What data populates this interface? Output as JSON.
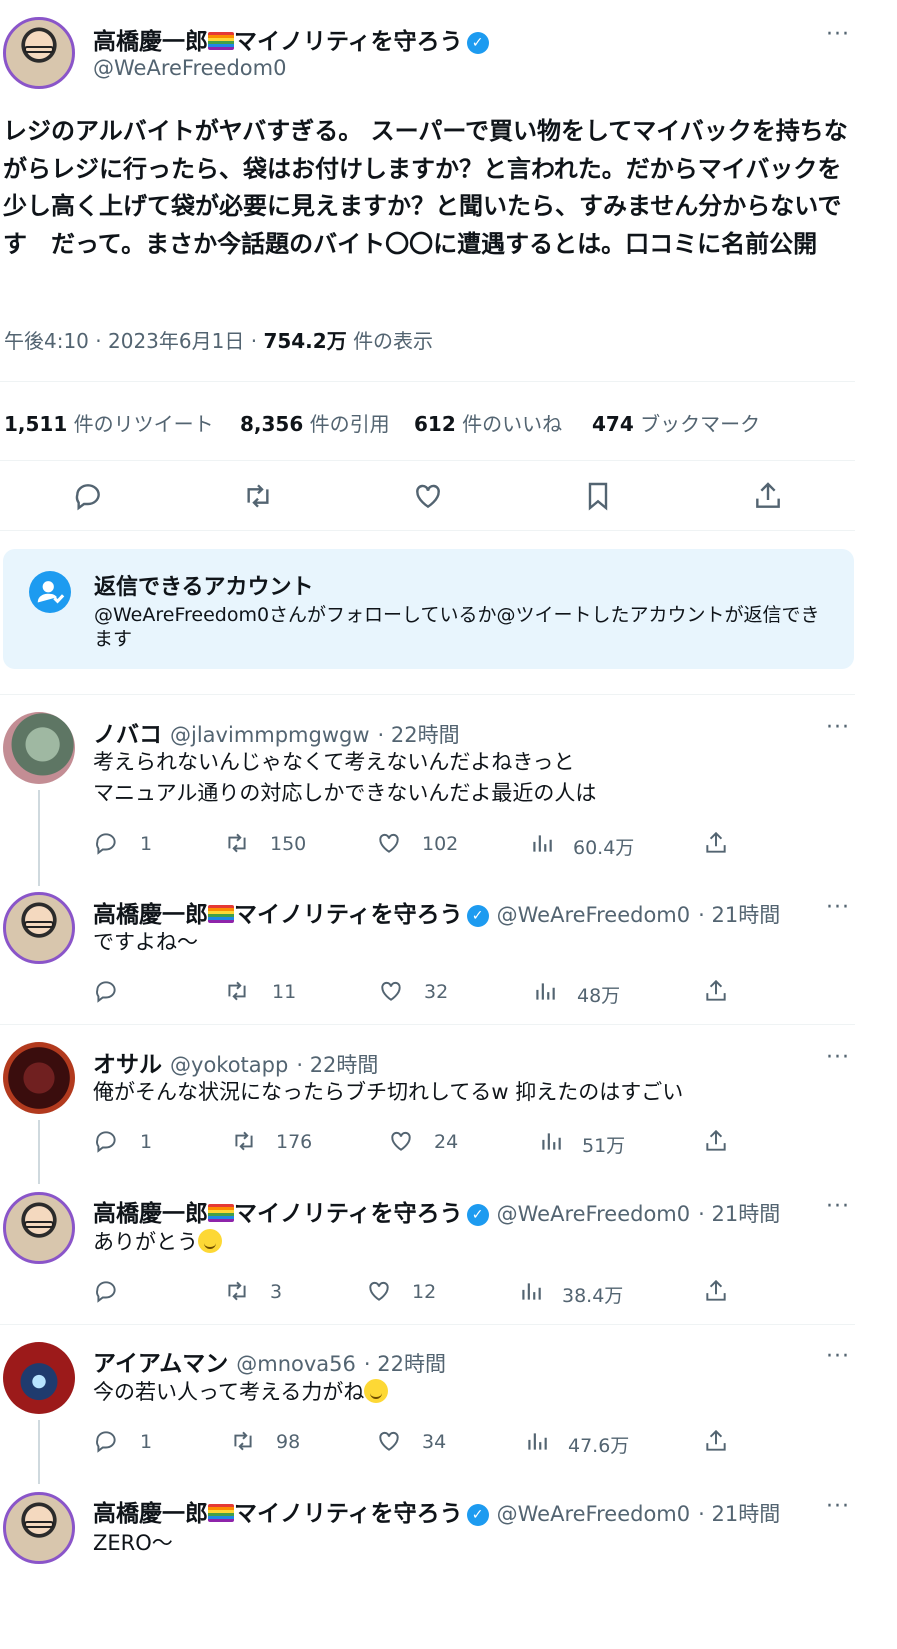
{
  "tweet": {
    "author_name": "高橋慶一郎",
    "author_name_suffix": "マイノリティを守ろう",
    "author_handle": "@WeAreFreedom0",
    "body": "レジのアルバイトがヤバすぎる。 スーパーで買い物をしてマイバックを持ちながらレジに行ったら、袋はお付けしますか？と言われた。だからマイバックを少し高く上げて袋が必要に見えますか？と聞いたら、すみません分からないです　だって。まさか今話題のバイト〇〇に遭遇するとは。口コミに名前公開",
    "time": "午後4:10",
    "date": "2023年6月1日",
    "views_count": "754.2万",
    "views_label": "件の表示",
    "more_icon": "more-dots-icon",
    "verified_icon": "verified-badge-icon"
  },
  "stats": {
    "retweets_count": "1,511",
    "retweets_label": "件のリツイート",
    "quotes_count": "8,356",
    "quotes_label": "件の引用",
    "likes_count": "612",
    "likes_label": "件のいいね",
    "bookmarks_count": "474",
    "bookmarks_label": "ブックマーク"
  },
  "actions": [
    "reply-icon",
    "retweet-icon",
    "like-icon",
    "bookmark-icon",
    "share-icon"
  ],
  "reply_restriction": {
    "title": "返信できるアカウント",
    "text": "@WeAreFreedom0さんがフォローしているか@ツイートしたアカウントが返信できます"
  },
  "replies": [
    {
      "name": "ノバコ",
      "handle": "@jlavimmpmgwgw",
      "time": "· 22時間",
      "text_lines": [
        "考えられないんじゃなくて考えないんだよねきっと",
        "マニュアル通りの対応しかできないんだよ最近の人は"
      ],
      "replies": "1",
      "retweets": "150",
      "likes": "102",
      "views": "60.4万"
    },
    {
      "name": "高橋慶一郎",
      "name_suffix": "マイノリティを守ろう",
      "handle": "@WeAreFreedom0",
      "time": "· 21時間",
      "text_lines": [
        "ですよね〜"
      ],
      "replies": "",
      "retweets": "11",
      "likes": "32",
      "views": "48万"
    },
    {
      "name": "オサル",
      "handle": "@yokotapp",
      "time": "· 22時間",
      "text_lines": [
        "俺がそんな状況になったらブチ切れしてるw 抑えたのはすごい"
      ],
      "replies": "1",
      "retweets": "176",
      "likes": "24",
      "views": "51万"
    },
    {
      "name": "高橋慶一郎",
      "name_suffix": "マイノリティを守ろう",
      "handle": "@WeAreFreedom0",
      "time": "· 21時間",
      "text_lines": [
        "ありがとう"
      ],
      "replies": "",
      "retweets": "3",
      "likes": "12",
      "views": "38.4万"
    },
    {
      "name": "アイアムマン",
      "handle": "@mnova56",
      "time": "· 22時間",
      "text_lines": [
        "今の若い人って考える力がね"
      ],
      "replies": "1",
      "retweets": "98",
      "likes": "34",
      "views": "47.6万"
    },
    {
      "name": "高橋慶一郎",
      "name_suffix": "マイノリティを守ろう",
      "handle": "@WeAreFreedom0",
      "time": "· 21時間",
      "text_lines": [
        "ZERO〜"
      ]
    }
  ],
  "colors": {
    "accent": "#1d9bf0",
    "text": "#0f1419",
    "secondary_text": "#536471",
    "banner_bg": "#e8f5fd"
  }
}
